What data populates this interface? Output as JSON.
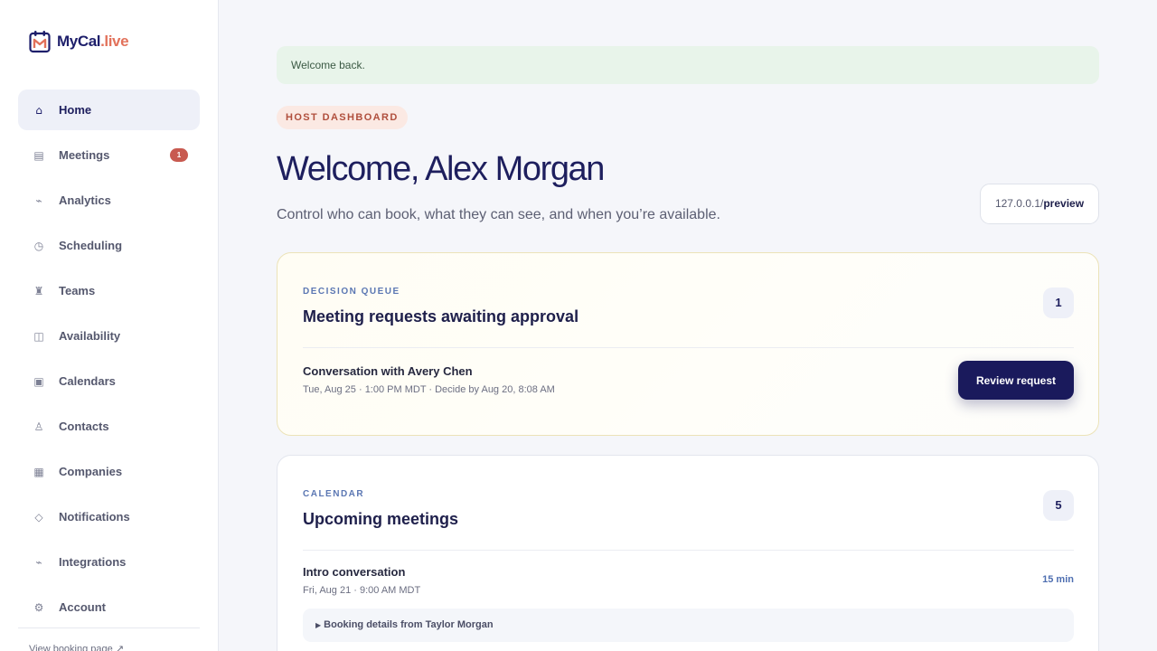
{
  "brand": {
    "name": "MyCal",
    "suffix": ".live"
  },
  "nav": {
    "items": [
      {
        "icon": "home-icon",
        "glyph": "⌂",
        "label": "Home",
        "active": true
      },
      {
        "icon": "meetings-icon",
        "glyph": "▤",
        "label": "Meetings",
        "badge": "1"
      },
      {
        "icon": "analytics-icon",
        "glyph": "⌁",
        "label": "Analytics"
      },
      {
        "icon": "clock-icon",
        "glyph": "◷",
        "label": "Scheduling"
      },
      {
        "icon": "teams-icon",
        "glyph": "♜",
        "label": "Teams"
      },
      {
        "icon": "availability-icon",
        "glyph": "◫",
        "label": "Availability"
      },
      {
        "icon": "calendar-icon",
        "glyph": "▣",
        "label": "Calendars"
      },
      {
        "icon": "contacts-icon",
        "glyph": "♙",
        "label": "Contacts"
      },
      {
        "icon": "companies-icon",
        "glyph": "▦",
        "label": "Companies"
      },
      {
        "icon": "notifications-icon",
        "glyph": "◇",
        "label": "Notifications"
      },
      {
        "icon": "integrations-icon",
        "glyph": "⌁",
        "label": "Integrations"
      },
      {
        "icon": "gear-icon",
        "glyph": "⚙",
        "label": "Account"
      }
    ],
    "booking_link": "View booking page ↗"
  },
  "flash": {
    "message": "Welcome back."
  },
  "header": {
    "eyebrow": "HOST DASHBOARD",
    "title": "Welcome, Alex Morgan",
    "subtitle": "Control who can book, what they can see, and when you’re available.",
    "preview_host": "127.0.0.1/",
    "preview_path": "preview"
  },
  "decision_queue": {
    "eyebrow": "DECISION QUEUE",
    "title": "Meeting requests awaiting approval",
    "count": "1",
    "item": {
      "title": "Conversation with Avery Chen",
      "meta": "Tue, Aug 25 · 1:00 PM MDT · Decide by Aug 20, 8:08 AM",
      "action": "Review request"
    }
  },
  "calendar": {
    "eyebrow": "CALENDAR",
    "title": "Upcoming meetings",
    "count": "5",
    "item": {
      "title": "Intro conversation",
      "meta": "Fri, Aug 21 · 9:00 AM MDT",
      "duration": "15 min",
      "details": "Booking details from Taylor Morgan"
    }
  },
  "colors": {
    "primary": "#1a1a5c",
    "accent": "#e2725b",
    "badge": "#c85a50",
    "flash_bg": "#e8f4ea",
    "eyebrow": "#5b77b3"
  }
}
